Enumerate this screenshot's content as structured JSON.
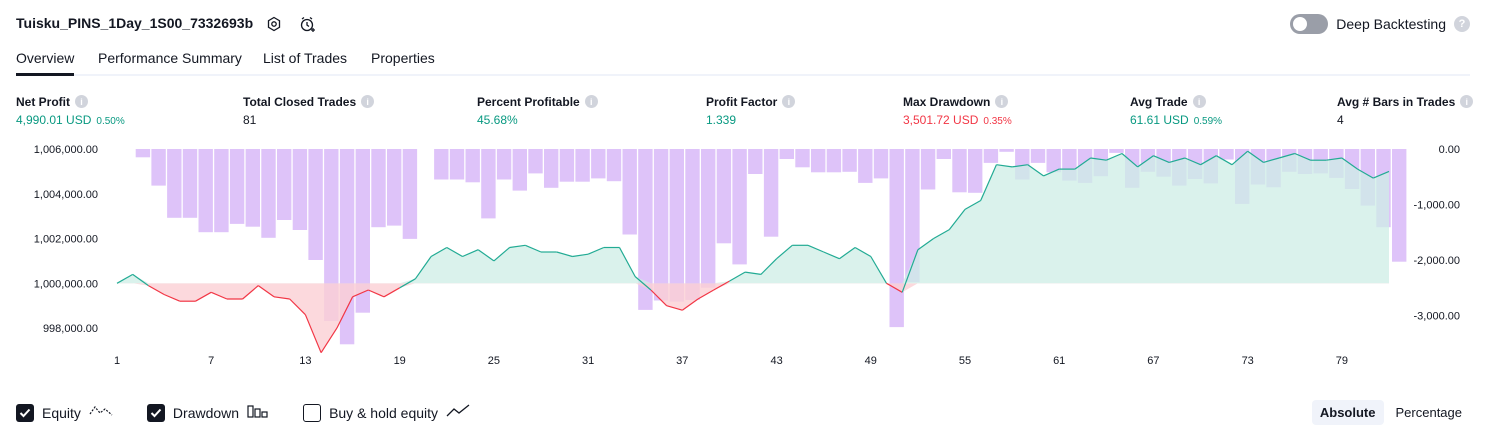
{
  "header": {
    "title": "Tuisku_PINS_1Day_1S00_7332693b",
    "deep_backtesting_label": "Deep Backtesting",
    "deep_backtesting_enabled": false
  },
  "tabs": [
    {
      "label": "Overview",
      "active": true
    },
    {
      "label": "Performance Summary",
      "active": false
    },
    {
      "label": "List of Trades",
      "active": false
    },
    {
      "label": "Properties",
      "active": false
    }
  ],
  "metrics": [
    {
      "label": "Net Profit",
      "value": "4,990.01 USD",
      "pct": "0.50%",
      "tone": "green"
    },
    {
      "label": "Total Closed Trades",
      "value": "81",
      "pct": "",
      "tone": "dark"
    },
    {
      "label": "Percent Profitable",
      "value": "45.68%",
      "pct": "",
      "tone": "green"
    },
    {
      "label": "Profit Factor",
      "value": "1.339",
      "pct": "",
      "tone": "green"
    },
    {
      "label": "Max Drawdown",
      "value": "3,501.72 USD",
      "pct": "0.35%",
      "tone": "red"
    },
    {
      "label": "Avg Trade",
      "value": "61.61 USD",
      "pct": "0.59%",
      "tone": "green"
    },
    {
      "label": "Avg # Bars in Trades",
      "value": "4",
      "pct": "",
      "tone": "dark"
    }
  ],
  "chart_data": {
    "type": "line",
    "x_ticks": [
      1,
      7,
      13,
      19,
      25,
      31,
      37,
      43,
      49,
      55,
      61,
      67,
      73,
      79
    ],
    "x_range": [
      1,
      82
    ],
    "left_axis": {
      "ticks": [
        "1,006,000.00",
        "1,004,000.00",
        "1,002,000.00",
        "1,000,000.00",
        "998,000.00"
      ],
      "range": [
        997200,
        1006000
      ],
      "baseline": 1000000
    },
    "right_axis": {
      "ticks": [
        "0.00",
        "-1,000.00",
        "-2,000.00",
        "-3,000.00"
      ],
      "range": [
        -3550,
        0
      ]
    },
    "series": [
      {
        "name": "Equity",
        "x": [
          1,
          2,
          3,
          4,
          5,
          6,
          7,
          8,
          9,
          10,
          11,
          12,
          13,
          14,
          15,
          16,
          17,
          18,
          19,
          20,
          21,
          22,
          23,
          24,
          25,
          26,
          27,
          28,
          29,
          30,
          31,
          32,
          33,
          34,
          35,
          36,
          37,
          38,
          39,
          40,
          41,
          42,
          43,
          44,
          45,
          46,
          47,
          48,
          49,
          50,
          51,
          52,
          53,
          54,
          55,
          56,
          57,
          58,
          59,
          60,
          61,
          62,
          63,
          64,
          65,
          66,
          67,
          68,
          69,
          70,
          71,
          72,
          73,
          74,
          75,
          76,
          77,
          78,
          79,
          80,
          81,
          82
        ],
        "values": [
          1000000,
          1000400,
          999900,
          999500,
          999200,
          999200,
          999600,
          999300,
          999300,
          999900,
          999400,
          999300,
          998600,
          996900,
          998000,
          999400,
          999700,
          999400,
          999800,
          1000200,
          1001200,
          1001600,
          1001200,
          1001500,
          1001000,
          1001600,
          1001700,
          1001400,
          1001400,
          1001200,
          1001300,
          1001600,
          1001600,
          1000300,
          999700,
          999000,
          998800,
          999300,
          999700,
          1000100,
          1000500,
          1000400,
          1001100,
          1001700,
          1001700,
          1001400,
          1001100,
          1001600,
          1001200,
          1000000,
          999600,
          1001500,
          1002000,
          1002400,
          1003300,
          1003700,
          1005300,
          1005200,
          1005300,
          1004800,
          1005100,
          1005100,
          1005600,
          1005500,
          1005800,
          1005200,
          1005700,
          1005400,
          1005600,
          1005300,
          1005700,
          1005300,
          1005900,
          1005400,
          1005600,
          1005800,
          1005500,
          1005500,
          1005600,
          1005100,
          1004700,
          1005000
        ]
      },
      {
        "name": "Drawdown",
        "x": [
          1,
          2,
          3,
          4,
          5,
          6,
          7,
          8,
          9,
          10,
          11,
          12,
          13,
          14,
          15,
          16,
          17,
          18,
          19,
          20,
          21,
          22,
          23,
          24,
          25,
          26,
          27,
          28,
          29,
          30,
          31,
          32,
          33,
          34,
          35,
          36,
          37,
          38,
          39,
          40,
          41,
          42,
          43,
          44,
          45,
          46,
          47,
          48,
          49,
          50,
          51,
          52,
          53,
          54,
          55,
          56,
          57,
          58,
          59,
          60,
          61,
          62,
          63,
          64,
          65,
          66,
          67,
          68,
          69,
          70,
          71,
          72,
          73,
          74,
          75,
          76,
          77,
          78,
          79,
          80,
          81,
          82
        ],
        "values": [
          0,
          -150,
          -660,
          -1240,
          -1240,
          -1500,
          -1500,
          -1350,
          -1400,
          -1600,
          -1280,
          -1460,
          -2000,
          -3100,
          -3520,
          -2950,
          -1410,
          -1380,
          -1620,
          0,
          -550,
          -550,
          -600,
          -1250,
          -550,
          -750,
          -440,
          -700,
          -590,
          -590,
          -530,
          -580,
          -1540,
          -2900,
          -2730,
          -2750,
          -2720,
          -2500,
          -1700,
          -2080,
          -450,
          -1580,
          -180,
          -330,
          -420,
          -420,
          -410,
          -610,
          -530,
          -3210,
          -2400,
          -730,
          -180,
          -780,
          -790,
          -250,
          -50,
          -550,
          -250,
          -420,
          -570,
          -610,
          -490,
          -70,
          -700,
          -410,
          -500,
          -660,
          -540,
          -620,
          -190,
          -990,
          -640,
          -690,
          -410,
          -450,
          -440,
          -520,
          -720,
          -1020,
          -1410,
          -2030
        ]
      }
    ],
    "series_colors": {
      "equity_up": "#22ab94",
      "equity_down": "#f23645",
      "drawdown": "#d8b8f8",
      "equity_fill_up": "#cdeee6",
      "equity_fill_down": "#fbd0d4"
    }
  },
  "legend": [
    {
      "label": "Equity",
      "checked": true,
      "icon": "equity-line-icon"
    },
    {
      "label": "Drawdown",
      "checked": true,
      "icon": "drawdown-bars-icon"
    },
    {
      "label": "Buy & hold equity",
      "checked": false,
      "icon": "buy-hold-line-icon"
    }
  ],
  "display_mode": {
    "options": [
      "Absolute",
      "Percentage"
    ],
    "selected": "Absolute"
  }
}
